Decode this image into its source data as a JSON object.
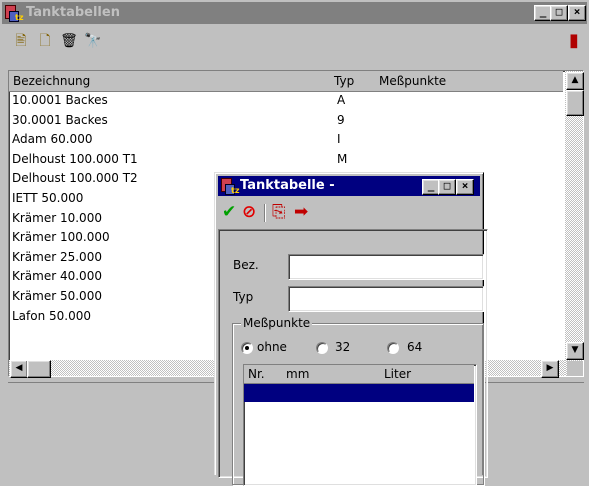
{
  "main_window": {
    "title": "Tanktabellen",
    "controls": [
      "_",
      "□",
      "×"
    ],
    "toolbar": [
      {
        "name": "new-icon",
        "glyph": "🖹"
      },
      {
        "name": "edit-icon",
        "glyph": "🗋"
      },
      {
        "name": "delete-icon",
        "glyph": "🗑"
      },
      {
        "name": "search-icon",
        "glyph": "🔭"
      },
      {
        "name": "exit-icon",
        "glyph": "▮"
      }
    ]
  },
  "list": {
    "columns": [
      "Bezeichnung",
      "Typ",
      "Meßpunkte"
    ],
    "rows": [
      {
        "name": "10.0001 Backes",
        "typ": "A"
      },
      {
        "name": "30.0001 Backes",
        "typ": "9"
      },
      {
        "name": "Adam 60.000",
        "typ": "I"
      },
      {
        "name": "Delhoust 100.000 T1",
        "typ": "M"
      },
      {
        "name": "Delhoust 100.000 T2",
        "typ": ""
      },
      {
        "name": "IETT 50.000",
        "typ": ""
      },
      {
        "name": "Krämer 10.000",
        "typ": ""
      },
      {
        "name": "Krämer 100.000",
        "typ": ""
      },
      {
        "name": "Krämer 25.000",
        "typ": ""
      },
      {
        "name": "Krämer 40.000",
        "typ": ""
      },
      {
        "name": "Krämer 50.000",
        "typ": ""
      },
      {
        "name": "Lafon 50.000",
        "typ": ""
      }
    ]
  },
  "dialog": {
    "title": "Tanktabelle -",
    "toolbar": [
      {
        "name": "ok-icon",
        "glyph": "✔",
        "color": "#00a000"
      },
      {
        "name": "cancel-icon",
        "glyph": "⊘",
        "color": "#e00000"
      },
      {
        "name": "copy-icon",
        "glyph": "⎘",
        "color": "#c00000"
      },
      {
        "name": "export-icon",
        "glyph": "➡",
        "color": "#c00000"
      }
    ],
    "bez_label": "Bez.",
    "bez_value": "",
    "typ_label": "Typ",
    "typ_value": "",
    "group_label": "Meßpunkte",
    "radios": [
      {
        "label": "ohne",
        "checked": true
      },
      {
        "label": "32",
        "checked": false
      },
      {
        "label": "64",
        "checked": false
      }
    ],
    "table_columns": [
      "Nr.",
      "mm",
      "Liter"
    ]
  }
}
